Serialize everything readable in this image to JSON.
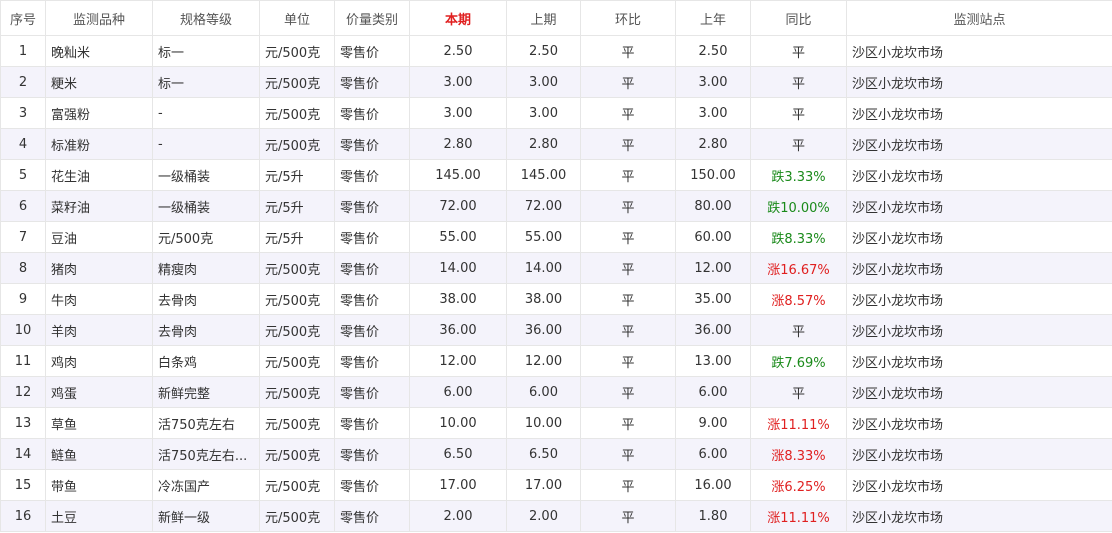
{
  "table": {
    "headers": {
      "seq": "序号",
      "name": "监测品种",
      "spec": "规格等级",
      "unit": "单位",
      "price_type": "价量类别",
      "current": "本期",
      "previous": "上期",
      "mom": "环比",
      "last_year": "上年",
      "yoy": "同比",
      "station": "监测站点"
    },
    "rows": [
      {
        "seq": "1",
        "name": "晚籼米",
        "spec": "标一",
        "unit": "元/500克",
        "price_type": "零售价",
        "current": "2.50",
        "previous": "2.50",
        "mom": "平",
        "last_year": "2.50",
        "yoy": "平",
        "yoy_trend": "flat",
        "station": "沙区小龙坎市场"
      },
      {
        "seq": "2",
        "name": "粳米",
        "spec": "标一",
        "unit": "元/500克",
        "price_type": "零售价",
        "current": "3.00",
        "previous": "3.00",
        "mom": "平",
        "last_year": "3.00",
        "yoy": "平",
        "yoy_trend": "flat",
        "station": "沙区小龙坎市场"
      },
      {
        "seq": "3",
        "name": "富强粉",
        "spec": "-",
        "unit": "元/500克",
        "price_type": "零售价",
        "current": "3.00",
        "previous": "3.00",
        "mom": "平",
        "last_year": "3.00",
        "yoy": "平",
        "yoy_trend": "flat",
        "station": "沙区小龙坎市场"
      },
      {
        "seq": "4",
        "name": "标准粉",
        "spec": "-",
        "unit": "元/500克",
        "price_type": "零售价",
        "current": "2.80",
        "previous": "2.80",
        "mom": "平",
        "last_year": "2.80",
        "yoy": "平",
        "yoy_trend": "flat",
        "station": "沙区小龙坎市场"
      },
      {
        "seq": "5",
        "name": "花生油",
        "spec": "一级桶装",
        "unit": "元/5升",
        "price_type": "零售价",
        "current": "145.00",
        "previous": "145.00",
        "mom": "平",
        "last_year": "150.00",
        "yoy": "跌3.33%",
        "yoy_trend": "down",
        "station": "沙区小龙坎市场"
      },
      {
        "seq": "6",
        "name": "菜籽油",
        "spec": "一级桶装",
        "unit": "元/5升",
        "price_type": "零售价",
        "current": "72.00",
        "previous": "72.00",
        "mom": "平",
        "last_year": "80.00",
        "yoy": "跌10.00%",
        "yoy_trend": "down",
        "station": "沙区小龙坎市场"
      },
      {
        "seq": "7",
        "name": "豆油",
        "spec": "元/500克",
        "unit": "元/5升",
        "price_type": "零售价",
        "current": "55.00",
        "previous": "55.00",
        "mom": "平",
        "last_year": "60.00",
        "yoy": "跌8.33%",
        "yoy_trend": "down",
        "station": "沙区小龙坎市场"
      },
      {
        "seq": "8",
        "name": "猪肉",
        "spec": "精瘦肉",
        "unit": "元/500克",
        "price_type": "零售价",
        "current": "14.00",
        "previous": "14.00",
        "mom": "平",
        "last_year": "12.00",
        "yoy": "涨16.67%",
        "yoy_trend": "up",
        "station": "沙区小龙坎市场"
      },
      {
        "seq": "9",
        "name": "牛肉",
        "spec": "去骨肉",
        "unit": "元/500克",
        "price_type": "零售价",
        "current": "38.00",
        "previous": "38.00",
        "mom": "平",
        "last_year": "35.00",
        "yoy": "涨8.57%",
        "yoy_trend": "up",
        "station": "沙区小龙坎市场"
      },
      {
        "seq": "10",
        "name": "羊肉",
        "spec": "去骨肉",
        "unit": "元/500克",
        "price_type": "零售价",
        "current": "36.00",
        "previous": "36.00",
        "mom": "平",
        "last_year": "36.00",
        "yoy": "平",
        "yoy_trend": "flat",
        "station": "沙区小龙坎市场"
      },
      {
        "seq": "11",
        "name": "鸡肉",
        "spec": "白条鸡",
        "unit": "元/500克",
        "price_type": "零售价",
        "current": "12.00",
        "previous": "12.00",
        "mom": "平",
        "last_year": "13.00",
        "yoy": "跌7.69%",
        "yoy_trend": "down",
        "station": "沙区小龙坎市场"
      },
      {
        "seq": "12",
        "name": "鸡蛋",
        "spec": "新鲜完整",
        "unit": "元/500克",
        "price_type": "零售价",
        "current": "6.00",
        "previous": "6.00",
        "mom": "平",
        "last_year": "6.00",
        "yoy": "平",
        "yoy_trend": "flat",
        "station": "沙区小龙坎市场"
      },
      {
        "seq": "13",
        "name": "草鱼",
        "spec": "活750克左右",
        "unit": "元/500克",
        "price_type": "零售价",
        "current": "10.00",
        "previous": "10.00",
        "mom": "平",
        "last_year": "9.00",
        "yoy": "涨11.11%",
        "yoy_trend": "up",
        "station": "沙区小龙坎市场"
      },
      {
        "seq": "14",
        "name": "鲢鱼",
        "spec": "活750克左右...",
        "unit": "元/500克",
        "price_type": "零售价",
        "current": "6.50",
        "previous": "6.50",
        "mom": "平",
        "last_year": "6.00",
        "yoy": "涨8.33%",
        "yoy_trend": "up",
        "station": "沙区小龙坎市场"
      },
      {
        "seq": "15",
        "name": "带鱼",
        "spec": "冷冻国产",
        "unit": "元/500克",
        "price_type": "零售价",
        "current": "17.00",
        "previous": "17.00",
        "mom": "平",
        "last_year": "16.00",
        "yoy": "涨6.25%",
        "yoy_trend": "up",
        "station": "沙区小龙坎市场"
      },
      {
        "seq": "16",
        "name": "土豆",
        "spec": "新鲜一级",
        "unit": "元/500克",
        "price_type": "零售价",
        "current": "2.00",
        "previous": "2.00",
        "mom": "平",
        "last_year": "1.80",
        "yoy": "涨11.11%",
        "yoy_trend": "up",
        "station": "沙区小龙坎市场"
      }
    ]
  },
  "colors": {
    "highlight_header": "#e02020",
    "rise": "#e02020",
    "fall": "#1a8a1a",
    "stripe": "#f4f3fb",
    "border": "#e6e6e6"
  }
}
